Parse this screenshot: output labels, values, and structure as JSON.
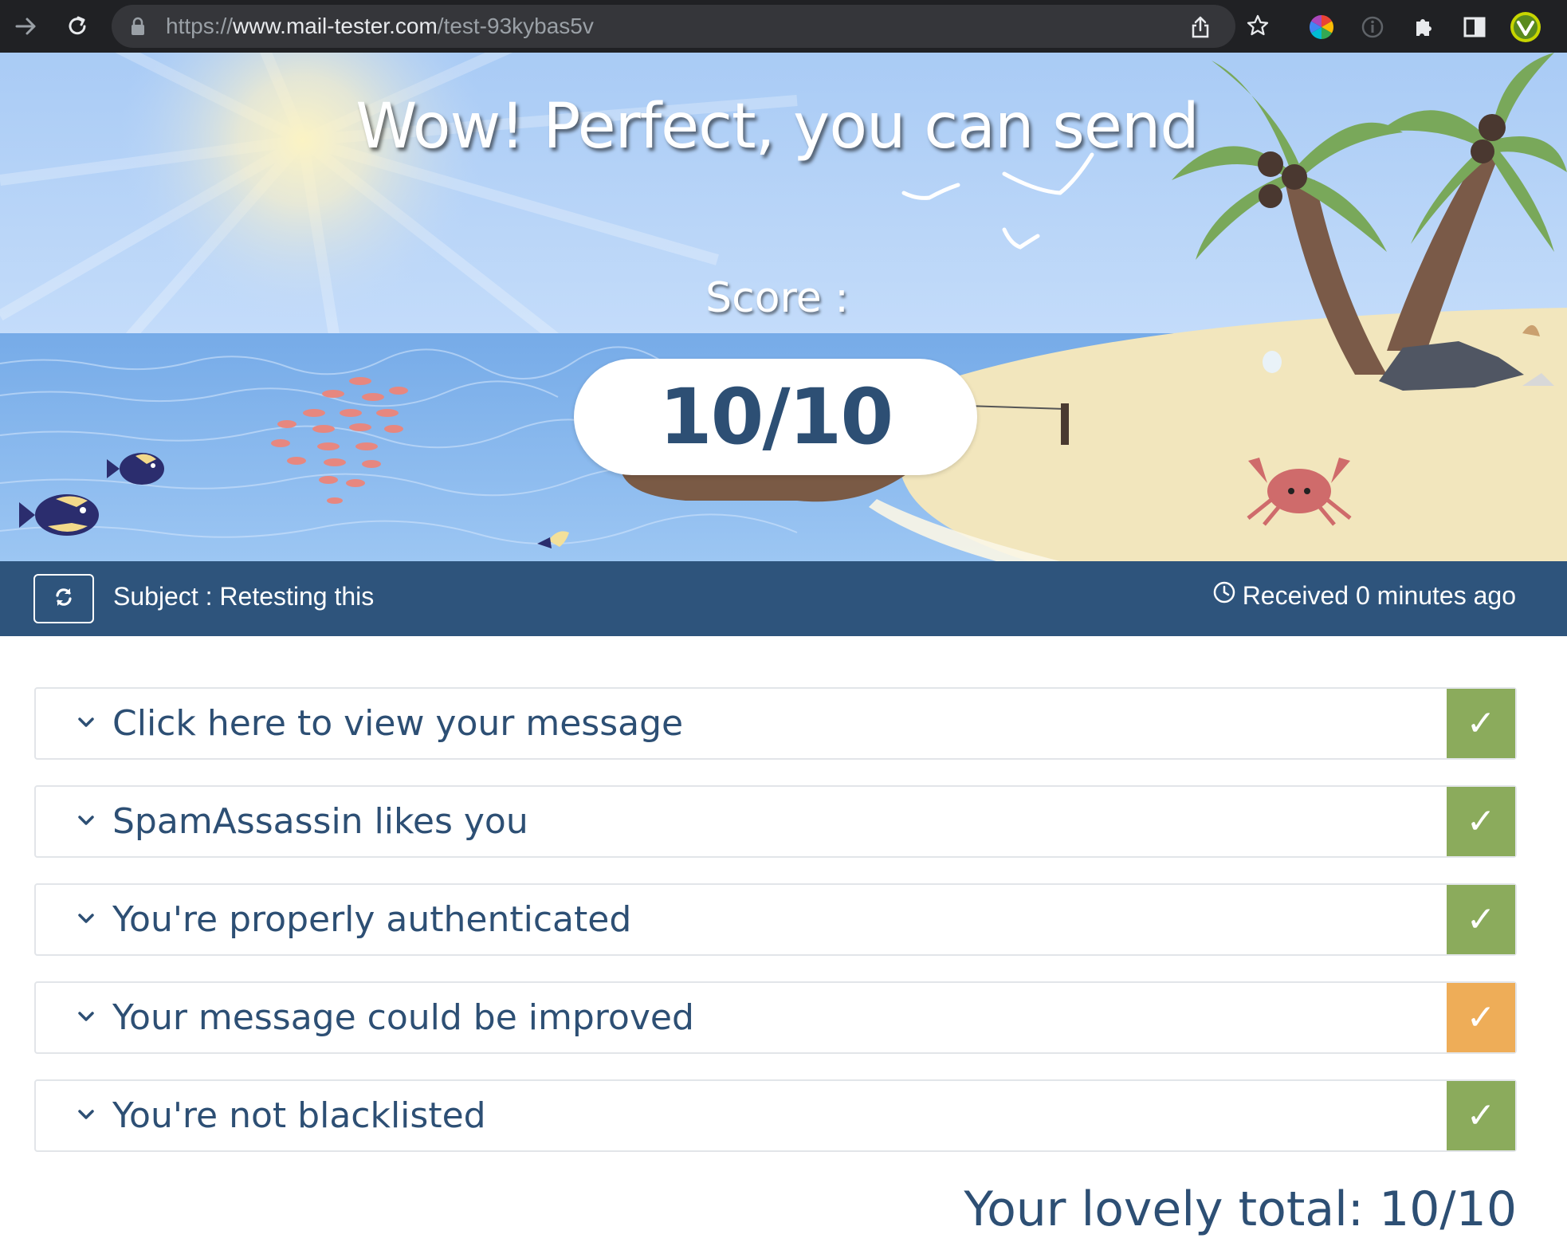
{
  "browser": {
    "url_scheme": "https://",
    "url_host": "www.mail-tester.com",
    "url_path": "/test-93kybas5v",
    "icons": [
      "forward-icon",
      "reload-icon",
      "lock-icon",
      "share-icon",
      "bookmark-star-icon",
      "color-extension-icon",
      "info-extension-icon",
      "puzzle-extensions-icon",
      "sidebar-icon",
      "profile-check-icon"
    ]
  },
  "hero": {
    "title": "Wow! Perfect, you can send",
    "score_label": "Score :",
    "score_value": "10/10"
  },
  "subject_bar": {
    "subject": "Subject : Retesting this",
    "received": "Received 0 minutes ago"
  },
  "results": [
    {
      "label": "Click here to view your message",
      "status": "ok",
      "color": "#8bab5c",
      "mark": "✓"
    },
    {
      "label": "SpamAssassin likes you",
      "status": "ok",
      "color": "#8bab5c",
      "mark": "✓"
    },
    {
      "label": "You're properly authenticated",
      "status": "ok",
      "color": "#8bab5c",
      "mark": "✓"
    },
    {
      "label": "Your message could be improved",
      "status": "warning",
      "color": "#eead58",
      "mark": "✓"
    },
    {
      "label": "You're not blacklisted",
      "status": "ok",
      "color": "#8bab5c",
      "mark": "✓"
    }
  ],
  "total": "Your lovely total: 10/10",
  "colors": {
    "brand_blue": "#2e547c",
    "text_blue": "#2d4f74",
    "ok_green": "#8bab5c",
    "warn_orange": "#eead58"
  }
}
